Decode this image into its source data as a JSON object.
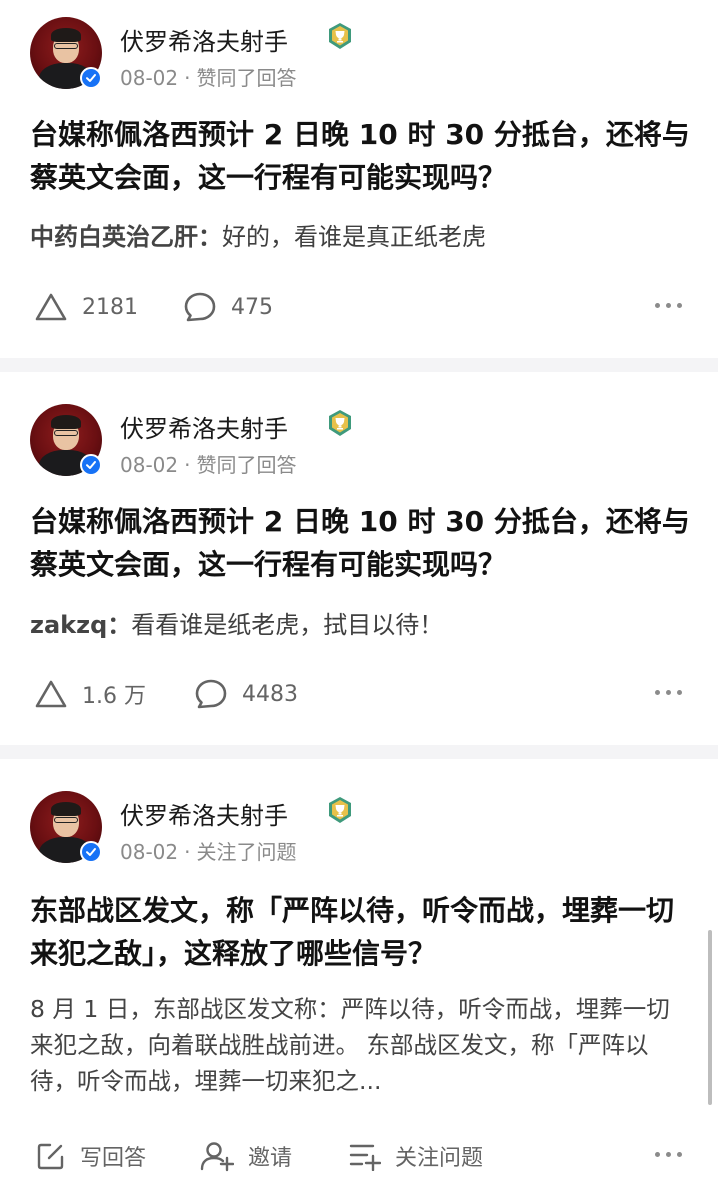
{
  "feed": [
    {
      "author": "伏罗希洛夫射手",
      "date": "08-02",
      "separator": "·",
      "action": "赞同了回答",
      "question": "台媒称佩洛西预计 2 日晚 10 时 30 分抵台，还将与蔡英文会面，这一行程有可能实现吗？",
      "excerpt_author": "中药白英治乙肝：",
      "excerpt_text": "好的，看谁是真正纸老虎",
      "upvotes": "2181",
      "comments": "475"
    },
    {
      "author": "伏罗希洛夫射手",
      "date": "08-02",
      "separator": "·",
      "action": "赞同了回答",
      "question": "台媒称佩洛西预计 2 日晚 10 时 30 分抵台，还将与蔡英文会面，这一行程有可能实现吗？",
      "excerpt_author": "zakzq：",
      "excerpt_text": "看看谁是纸老虎，拭目以待！",
      "upvotes": "1.6 万",
      "comments": "4483"
    },
    {
      "author": "伏罗希洛夫射手",
      "date": "08-02",
      "separator": "·",
      "action": "关注了问题",
      "question": "东部战区发文，称「严阵以待，听令而战，埋葬一切来犯之敌」，这释放了哪些信号？",
      "excerpt_text": "8 月 1 日，东部战区发文称：严阵以待，听令而战，埋葬一切来犯之敌，向着联战胜战前进。 东部战区发文，称「严阵以待，听令而战，埋葬一切来犯之...",
      "write_answer": "写回答",
      "invite": "邀请",
      "follow_question": "关注问题"
    }
  ],
  "icons": {
    "badge": "trophy-badge-icon",
    "verified": "verified-check-icon",
    "upvote": "upvote-triangle-icon",
    "comment": "comment-bubble-icon",
    "more": "more-dots-icon",
    "write": "edit-icon",
    "invite": "invite-user-icon",
    "follow": "follow-list-icon"
  },
  "colors": {
    "verified": "#1772f6",
    "badge": "#3f9a7c",
    "avatar_bg": "#7a1216",
    "meta_text": "#8a8a8a"
  }
}
